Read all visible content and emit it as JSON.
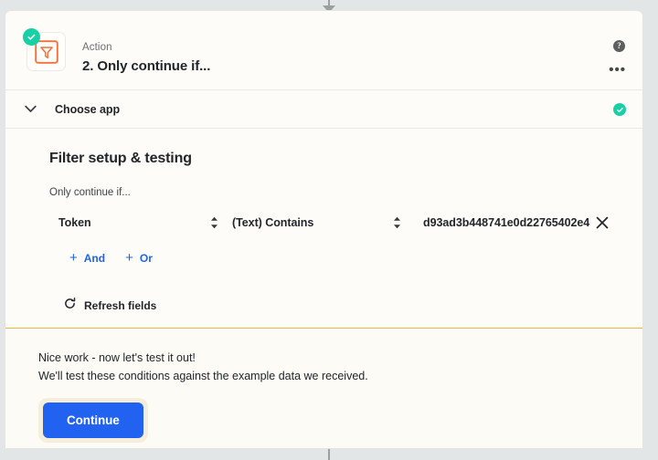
{
  "connectors": {
    "top_arrow_icon": "arrow-down-icon",
    "bottom_line_icon": "connector-line-icon"
  },
  "header": {
    "kicker": "Action",
    "title": "2. Only continue if...",
    "app_icon_name": "filter-funnel-icon",
    "status_badge_icon": "check-circle-icon",
    "help_icon": "question-mark-icon",
    "help_glyph": "?",
    "more_icon": "ellipsis-icon",
    "more_glyph": "•••"
  },
  "choose_app": {
    "label": "Choose app",
    "chevron_icon": "chevron-down-icon",
    "complete_icon": "check-circle-icon"
  },
  "filter_setup": {
    "title": "Filter setup & testing",
    "sub_label": "Only continue if...",
    "condition": {
      "field": "Token",
      "operator": "(Text) Contains",
      "value": "d93ad3b448741e0d22765402e4",
      "field_stepper_icon": "stepper-up-down-icon",
      "operator_stepper_icon": "stepper-up-down-icon",
      "remove_icon": "close-x-icon"
    },
    "logic": {
      "and_label": "And",
      "or_label": "Or",
      "plus_glyph": "+"
    },
    "refresh": {
      "label": "Refresh fields",
      "icon": "refresh-icon"
    }
  },
  "test_panel": {
    "line1": "Nice work - now let's test it out!",
    "line2": "We'll test these conditions against the example data we received.",
    "continue_label": "Continue"
  },
  "colors": {
    "accent_blue": "#2163f0",
    "success_green": "#19cfa4",
    "filter_orange": "#f4713c",
    "panel_border_yellow": "#edb83f",
    "card_bg": "#fdfcf8",
    "page_bg": "#e3e6e6"
  }
}
